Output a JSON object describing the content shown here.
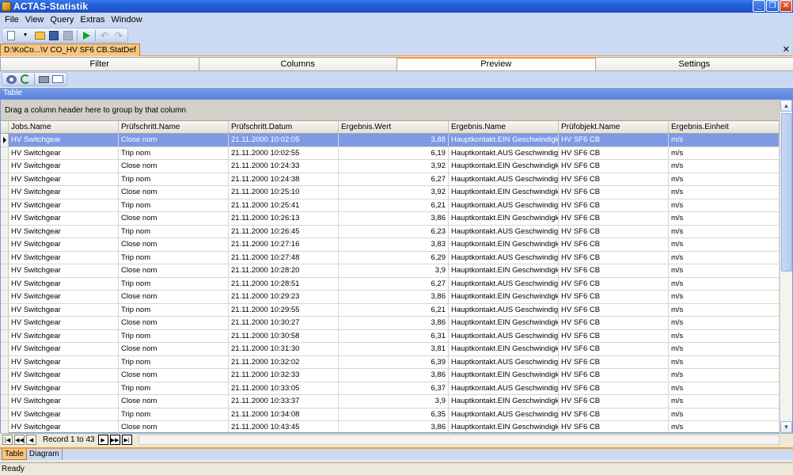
{
  "window": {
    "title": "ACTAS-Statistik"
  },
  "menu": [
    {
      "label": "File"
    },
    {
      "label": "View"
    },
    {
      "label": "Query"
    },
    {
      "label": "Extras"
    },
    {
      "label": "Window"
    }
  ],
  "document_tab": {
    "label": "D:\\KoCo...\\V CO_HV SF6 CB.StatDef"
  },
  "tabs": [
    {
      "label": "Filter"
    },
    {
      "label": "Columns"
    },
    {
      "label": "Preview",
      "active": true
    },
    {
      "label": "Settings"
    }
  ],
  "panel": {
    "title": "Table"
  },
  "grid": {
    "group_hint": "Drag a column header here to group by that column",
    "columns": [
      "Jobs.Name",
      "Prüfschritt.Name",
      "Prüfschritt.Datum",
      "Ergebnis.Wert",
      "Ergebnis.Name",
      "Prüfobjekt.Name",
      "Ergebnis.Einheit"
    ],
    "rows": [
      [
        "HV Switchgear",
        "Close nom",
        "21.11.2000 10:02:05",
        "3,88",
        "Hauptkontakt.EIN Geschwindigk...",
        "HV SF6 CB",
        "m/s"
      ],
      [
        "HV Switchgear",
        "Trip nom",
        "21.11.2000 10:02:55",
        "6,19",
        "Hauptkontakt.AUS Geschwindigk...",
        "HV SF6 CB",
        "m/s"
      ],
      [
        "HV Switchgear",
        "Close nom",
        "21.11.2000 10:24:33",
        "3,92",
        "Hauptkontakt.EIN Geschwindigk...",
        "HV SF6 CB",
        "m/s"
      ],
      [
        "HV Switchgear",
        "Trip nom",
        "21.11.2000 10:24:38",
        "6,27",
        "Hauptkontakt.AUS Geschwindigk...",
        "HV SF6 CB",
        "m/s"
      ],
      [
        "HV Switchgear",
        "Close nom",
        "21.11.2000 10:25:10",
        "3,92",
        "Hauptkontakt.EIN Geschwindigk...",
        "HV SF6 CB",
        "m/s"
      ],
      [
        "HV Switchgear",
        "Trip nom",
        "21.11.2000 10:25:41",
        "6,21",
        "Hauptkontakt.AUS Geschwindigk...",
        "HV SF6 CB",
        "m/s"
      ],
      [
        "HV Switchgear",
        "Close nom",
        "21.11.2000 10:26:13",
        "3,86",
        "Hauptkontakt.EIN Geschwindigk...",
        "HV SF6 CB",
        "m/s"
      ],
      [
        "HV Switchgear",
        "Trip nom",
        "21.11.2000 10:26:45",
        "6,23",
        "Hauptkontakt.AUS Geschwindigk...",
        "HV SF6 CB",
        "m/s"
      ],
      [
        "HV Switchgear",
        "Close nom",
        "21.11.2000 10:27:16",
        "3,83",
        "Hauptkontakt.EIN Geschwindigk...",
        "HV SF6 CB",
        "m/s"
      ],
      [
        "HV Switchgear",
        "Trip nom",
        "21.11.2000 10:27:48",
        "6,29",
        "Hauptkontakt.AUS Geschwindigk...",
        "HV SF6 CB",
        "m/s"
      ],
      [
        "HV Switchgear",
        "Close nom",
        "21.11.2000 10:28:20",
        "3,9",
        "Hauptkontakt.EIN Geschwindigk...",
        "HV SF6 CB",
        "m/s"
      ],
      [
        "HV Switchgear",
        "Trip nom",
        "21.11.2000 10:28:51",
        "6,27",
        "Hauptkontakt.AUS Geschwindigk...",
        "HV SF6 CB",
        "m/s"
      ],
      [
        "HV Switchgear",
        "Close nom",
        "21.11.2000 10:29:23",
        "3,86",
        "Hauptkontakt.EIN Geschwindigk...",
        "HV SF6 CB",
        "m/s"
      ],
      [
        "HV Switchgear",
        "Trip nom",
        "21.11.2000 10:29:55",
        "6,21",
        "Hauptkontakt.AUS Geschwindigk...",
        "HV SF6 CB",
        "m/s"
      ],
      [
        "HV Switchgear",
        "Close nom",
        "21.11.2000 10:30:27",
        "3,86",
        "Hauptkontakt.EIN Geschwindigk...",
        "HV SF6 CB",
        "m/s"
      ],
      [
        "HV Switchgear",
        "Trip nom",
        "21.11.2000 10:30:58",
        "6,31",
        "Hauptkontakt.AUS Geschwindigk...",
        "HV SF6 CB",
        "m/s"
      ],
      [
        "HV Switchgear",
        "Close nom",
        "21.11.2000 10:31:30",
        "3,81",
        "Hauptkontakt.EIN Geschwindigk...",
        "HV SF6 CB",
        "m/s"
      ],
      [
        "HV Switchgear",
        "Trip nom",
        "21.11.2000 10:32:02",
        "6,39",
        "Hauptkontakt.AUS Geschwindigk...",
        "HV SF6 CB",
        "m/s"
      ],
      [
        "HV Switchgear",
        "Close nom",
        "21.11.2000 10:32:33",
        "3,86",
        "Hauptkontakt.EIN Geschwindigk...",
        "HV SF6 CB",
        "m/s"
      ],
      [
        "HV Switchgear",
        "Trip nom",
        "21.11.2000 10:33:05",
        "6,37",
        "Hauptkontakt.AUS Geschwindigk...",
        "HV SF6 CB",
        "m/s"
      ],
      [
        "HV Switchgear",
        "Close nom",
        "21.11.2000 10:33:37",
        "3,9",
        "Hauptkontakt.EIN Geschwindigk...",
        "HV SF6 CB",
        "m/s"
      ],
      [
        "HV Switchgear",
        "Trip nom",
        "21.11.2000 10:34:08",
        "6,35",
        "Hauptkontakt.AUS Geschwindigk...",
        "HV SF6 CB",
        "m/s"
      ],
      [
        "HV Switchgear",
        "Close nom",
        "21.11.2000 10:43:45",
        "3,86",
        "Hauptkontakt.EIN Geschwindigk...",
        "HV SF6 CB",
        "m/s"
      ]
    ]
  },
  "navigator": {
    "record_text": "Record 1 to 43"
  },
  "bottom_tabs": [
    {
      "label": "Table",
      "active": true
    },
    {
      "label": "Diagram"
    }
  ],
  "status": {
    "text": "Ready"
  },
  "colors": {
    "title_bar": "#2456cc",
    "selection": "#7f9ae4",
    "accent_orange": "#f09a3b",
    "menu_bg": "#ccd9f2"
  }
}
